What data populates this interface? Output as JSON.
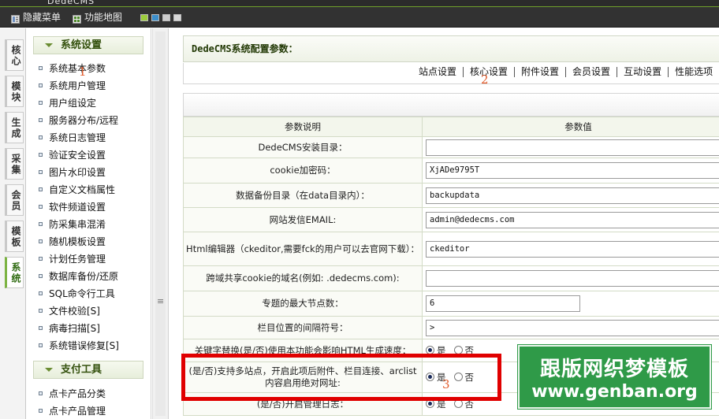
{
  "app": {
    "brand": "DedeCMS"
  },
  "toolbar": {
    "hide_menu": "隐藏菜单",
    "site_map": "功能地图",
    "swatches": [
      "#9ccc3c",
      "#3c8fcc",
      "#cccccc",
      "#d8d8d8"
    ]
  },
  "vtabs": [
    "核心",
    "模块",
    "生成",
    "采集",
    "会员",
    "模板",
    "系统"
  ],
  "sidebar": {
    "section1": "系统设置",
    "items1": [
      "系统基本参数",
      "系统用户管理",
      "用户组设定",
      "服务器分布/远程",
      "系统日志管理",
      "验证安全设置",
      "图片水印设置",
      "自定义文档属性",
      "软件频道设置",
      "防采集串混淆",
      "随机模板设置",
      "计划任务管理",
      "数据库备份/还原",
      "SQL命令行工具",
      "文件校验[S]",
      "病毒扫描[S]",
      "系统错误修复[S]"
    ],
    "section2": "支付工具",
    "items2": [
      "点卡产品分类",
      "点卡产品管理"
    ]
  },
  "annotations": {
    "a1": "1",
    "a2": "2",
    "a3": "3"
  },
  "main": {
    "title": "DedeCMS系统配置参数：",
    "tabs": [
      "站点设置",
      "核心设置",
      "附件设置",
      "会员设置",
      "互动设置",
      "性能选项"
    ],
    "col_label": "参数说明",
    "col_value": "参数值",
    "rows": [
      {
        "label": "DedeCMS安装目录：",
        "value": ""
      },
      {
        "label": "cookie加密码：",
        "value": "XjADe9795T"
      },
      {
        "label": "数据备份目录（在data目录内）：",
        "value": "backupdata"
      },
      {
        "label": "网站发信EMAIL:",
        "value": "admin@dedecms.com"
      },
      {
        "label": "Html编辑器（ckeditor,需要fck的用户可以去官网下载）：",
        "value": "ckeditor"
      },
      {
        "label": "跨域共享cookie的域名(例如: .dedecms.com):",
        "value": ""
      },
      {
        "label": "专题的最大节点数：",
        "value": "6"
      },
      {
        "label": "栏目位置的间隔符号：",
        "value": ">"
      },
      {
        "label": "关键字替换(是/否)使用本功能会影响HTML生成速度：",
        "yes": "是",
        "no": "否",
        "checked": "yes"
      },
      {
        "label": "(是/否)支持多站点，开启此项后附件、栏目连接、arclist内容启用绝对网址:",
        "yes": "是",
        "no": "否",
        "checked": "yes"
      },
      {
        "label": "(是/否)开启管理日志：",
        "yes": "是",
        "no": "否",
        "checked": "yes"
      }
    ]
  },
  "watermark": {
    "line1": "跟版网织梦模板",
    "line2": "www.genban.org"
  }
}
